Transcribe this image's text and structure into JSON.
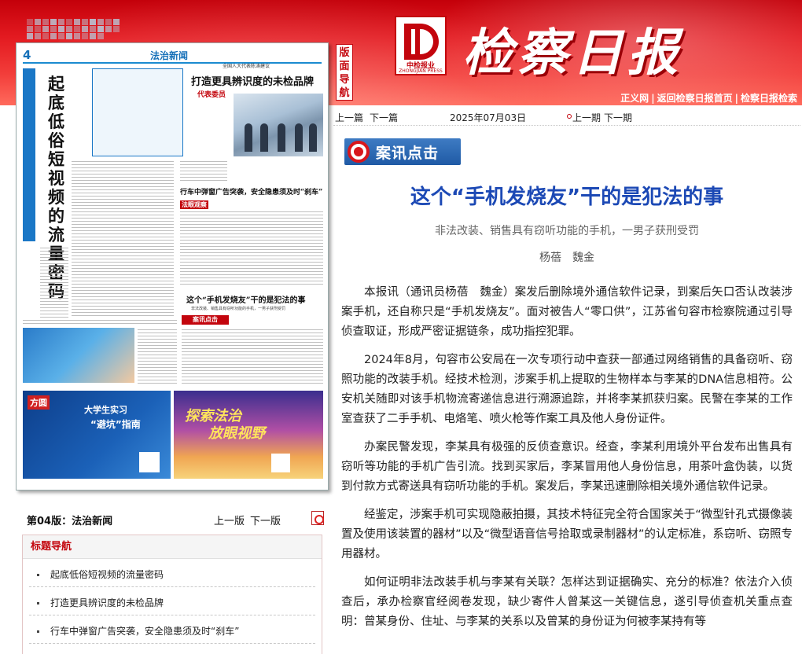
{
  "header": {
    "paper_title": "检察日报",
    "logo_text": "中检报业",
    "logo_sub": "ZHONGJIAN PRESS",
    "layout_nav_label": "版面导航",
    "top_links": [
      "正义网",
      "返回检察日报首页",
      "检察日报检索"
    ]
  },
  "page_thumbnail": {
    "page_number": "4",
    "section": "法治新闻",
    "lead_title": "起底低俗短视频的流量密码",
    "right_title_1": "打造更具辨识度的未检品牌",
    "right_subtitle_1": "全国人大代表陈涛建议",
    "rep_tag": "代表委员",
    "right_title_2": "行车中弹窗广告突袭，安全隐患须及时“刹车”",
    "rule_tag": "法眼观察",
    "mid_title": "这个“手机发烧友”干的是犯法的事",
    "mid_subtitle": "非法改装、销售具有窃听功能的手机，一男子获刑受罚",
    "case_tag": "案讯点击",
    "ad1_brand": "方圆",
    "ad1_title_1": "大学生实习",
    "ad1_title_2": "“避坑”指南",
    "ad2_title_1": "探索法治",
    "ad2_title_2": "放眼视野"
  },
  "page_strip": {
    "current": "第04版：法治新闻",
    "prev": "上一版",
    "next": "下一版"
  },
  "title_nav": {
    "heading": "标题导航",
    "items": [
      "起底低俗短视频的流量密码",
      "打造更具辨识度的未检品牌",
      "行车中弹窗广告突袭，安全隐患须及时“刹车”"
    ]
  },
  "article_nav": {
    "prev_article": "上一篇",
    "next_article": "下一篇",
    "date": "2025年07月03日",
    "prev_issue": "上一期",
    "next_issue": "下一期"
  },
  "article": {
    "column": "案讯点击",
    "headline": "这个“手机发烧友”干的是犯法的事",
    "subhead": "非法改装、销售具有窃听功能的手机，一男子获刑受罚",
    "authors": "杨蓓　魏金",
    "paragraphs": [
      "本报讯（通讯员杨蓓　魏金）案发后删除境外通信软件记录，到案后矢口否认改装涉案手机，还自称只是“手机发烧友”。面对被告人“零口供”，江苏省句容市检察院通过引导侦查取证，形成严密证据链条，成功指控犯罪。",
      "2024年8月，句容市公安局在一次专项行动中查获一部通过网络销售的具备窃听、窃照功能的改装手机。经技术检测，涉案手机上提取的生物样本与李某的DNA信息相符。公安机关随即对该手机物流寄递信息进行溯源追踪，并将李某抓获归案。民警在李某的工作室查获了二手手机、电烙笔、喷火枪等作案工具及他人身份证件。",
      "办案民警发现，李某具有极强的反侦查意识。经查，李某利用境外平台发布出售具有窃听等功能的手机广告引流。找到买家后，李某冒用他人身份信息，用茶叶盒伪装，以货到付款方式寄送具有窃听功能的手机。案发后，李某迅速删除相关境外通信软件记录。",
      "经鉴定，涉案手机可实现隐蔽拍摄，其技术特征完全符合国家关于“微型针孔式摄像装置及使用该装置的器材”以及“微型语音信号拾取或录制器材”的认定标准，系窃听、窃照专用器材。",
      "如何证明非法改装手机与李某有关联？怎样达到证据确实、充分的标准？依法介入侦查后，承办检察官经阅卷发现，缺少寄件人曾某这一关键信息，遂引导侦查机关重点查明：曾某身份、住址、与李某的关系以及曾某的身份证为何被李某持有等"
    ]
  },
  "colors": {
    "brand_red": "#c3050d",
    "headline_blue": "#1c49b5",
    "section_blue": "#1570b8"
  }
}
